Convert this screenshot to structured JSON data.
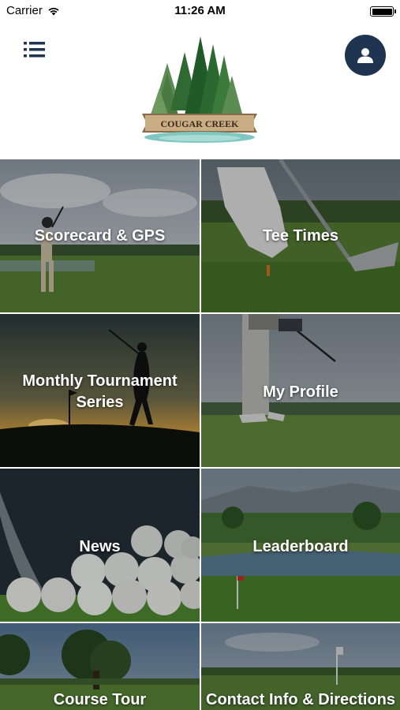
{
  "status_bar": {
    "carrier": "Carrier",
    "time": "11:26 AM",
    "icons": [
      "wifi-icon",
      "battery-icon"
    ]
  },
  "header": {
    "menu_icon": "menu-list-icon",
    "profile_icon": "user-icon",
    "logo_text": "COUGAR CREEK",
    "colors": {
      "profile_button": "#1f3450",
      "menu_icon": "#1f3450"
    }
  },
  "tiles": [
    {
      "label": "Scorecard & GPS"
    },
    {
      "label": "Tee Times"
    },
    {
      "label": "Monthly Tournament Series"
    },
    {
      "label": "My Profile"
    },
    {
      "label": "News"
    },
    {
      "label": "Leaderboard"
    },
    {
      "label": "Course Tour"
    },
    {
      "label": "Contact Info & Directions"
    }
  ]
}
